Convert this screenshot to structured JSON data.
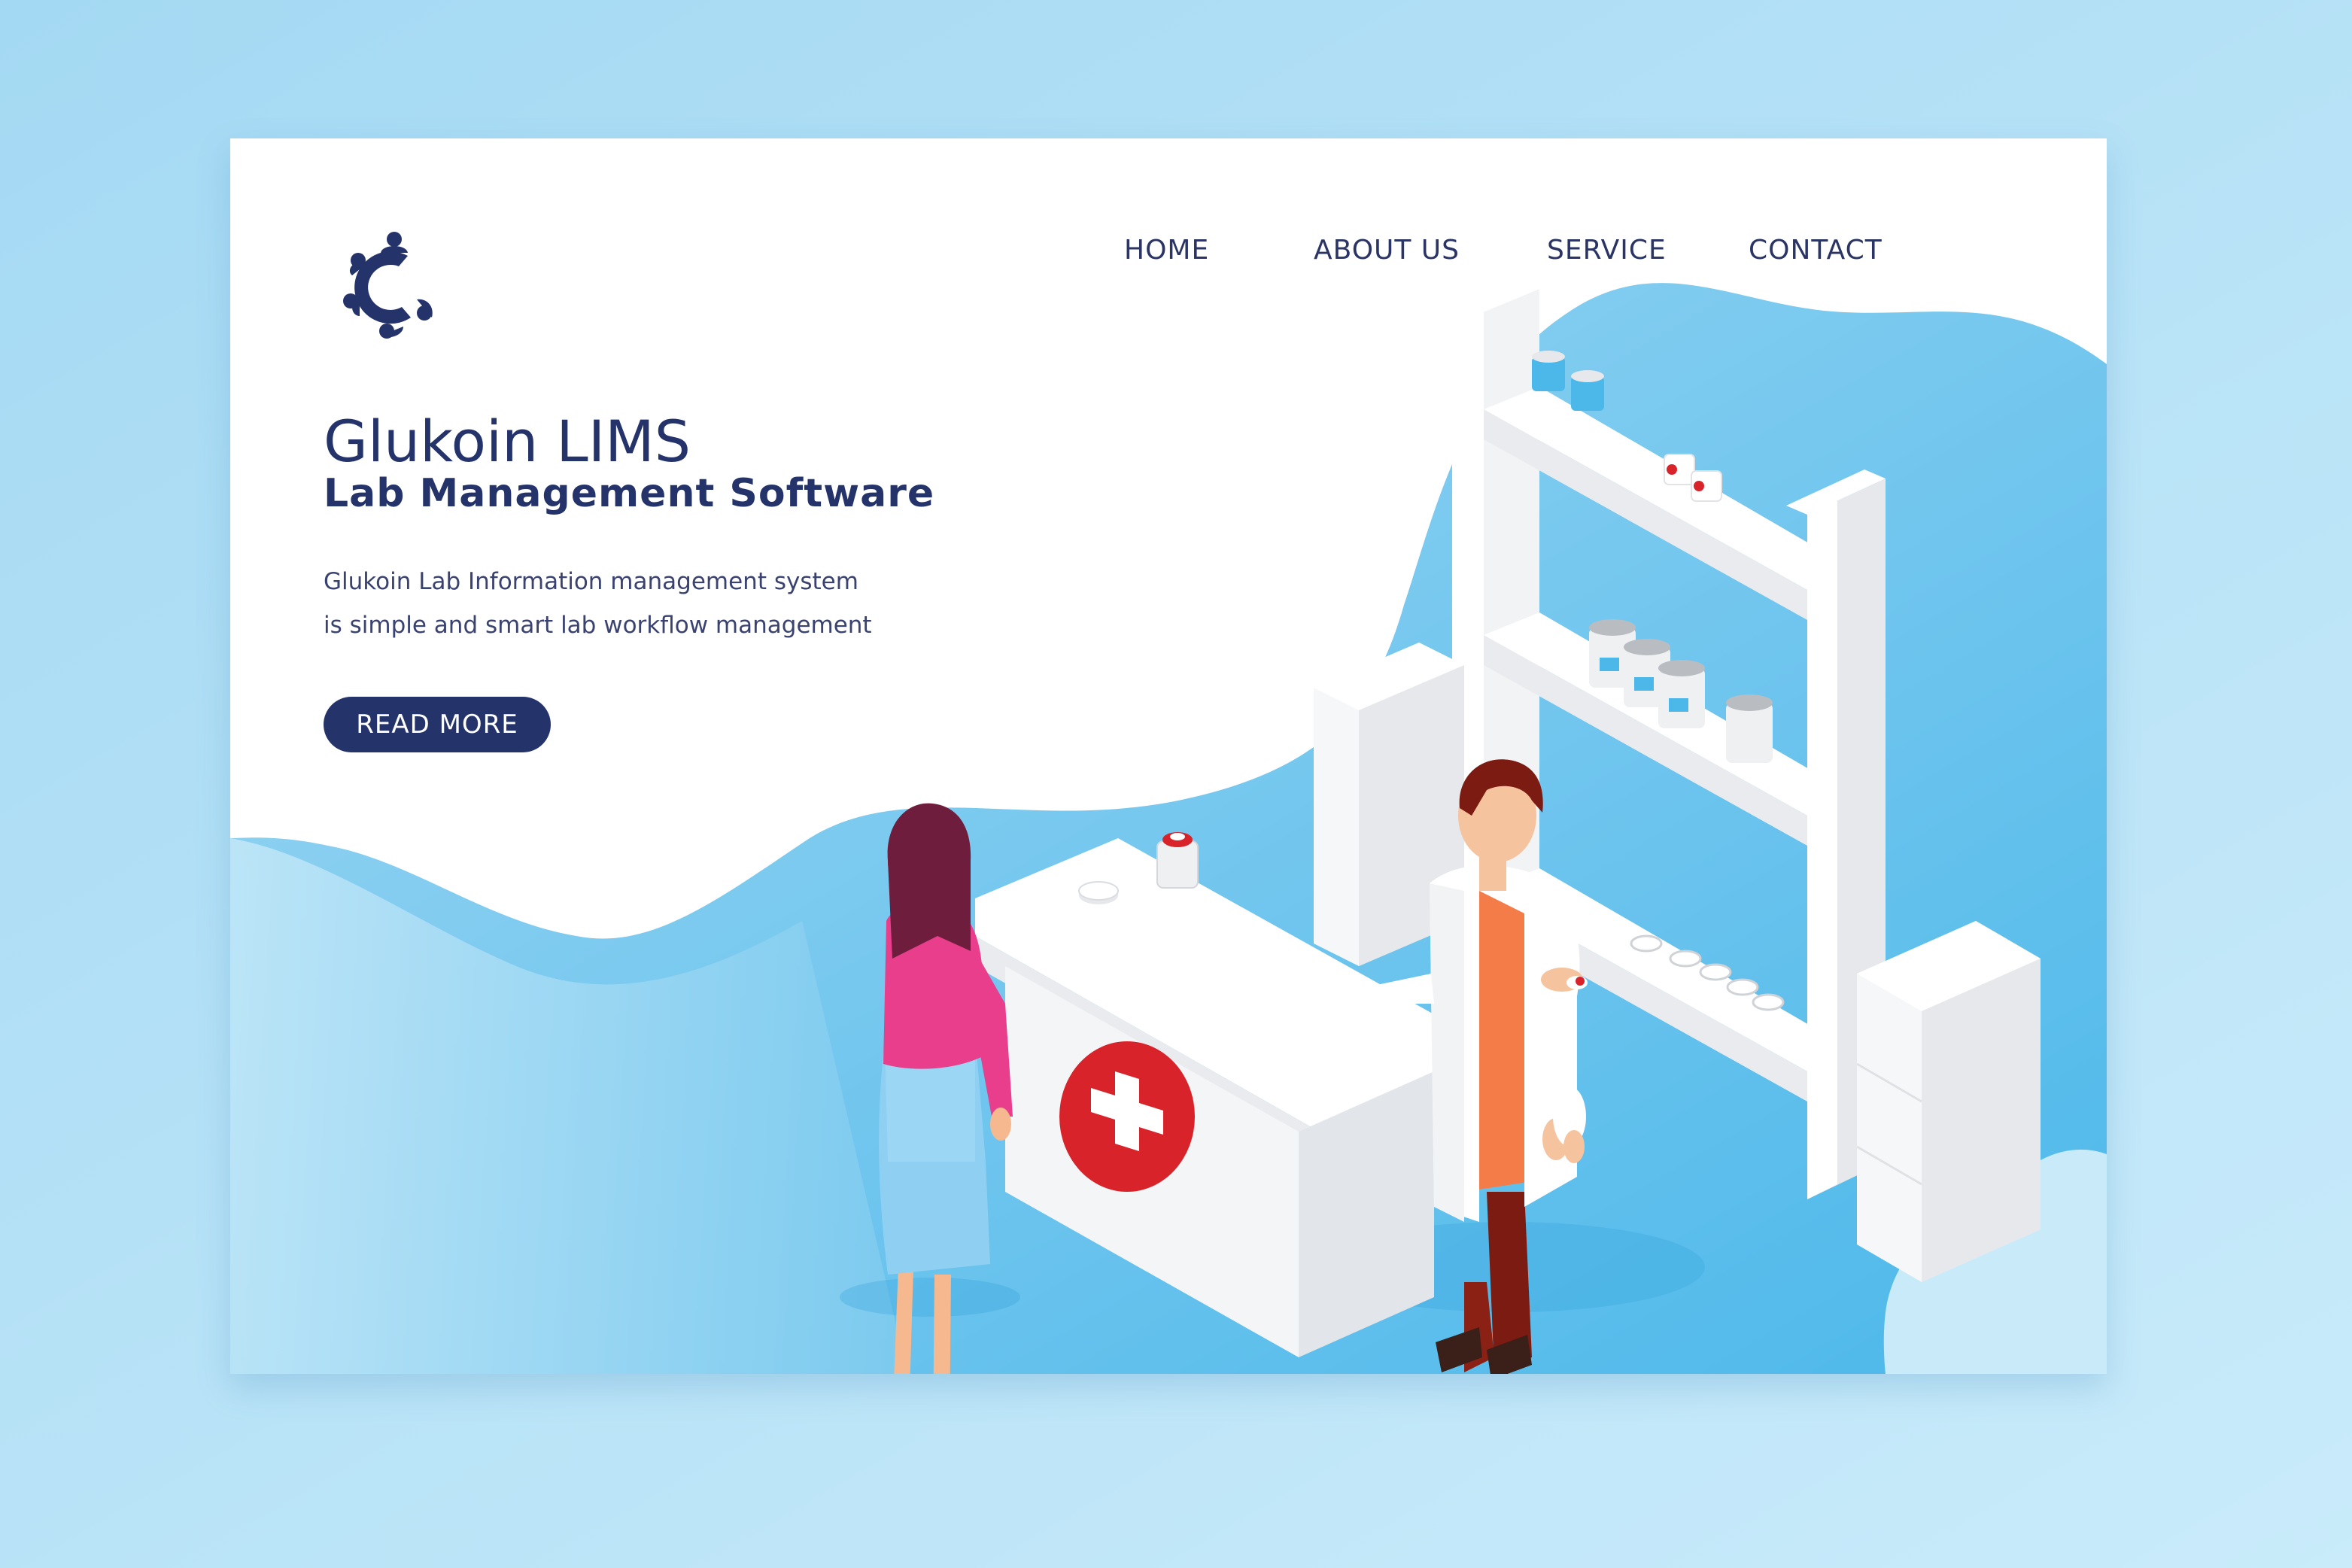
{
  "nav": {
    "items": [
      {
        "label": "HOME"
      },
      {
        "label": "ABOUT US"
      },
      {
        "label": "SERVICE"
      },
      {
        "label": "CONTACT"
      }
    ]
  },
  "hero": {
    "title": "Glukoin LIMS",
    "subtitle": "Lab Management Software",
    "description_lines": [
      "Glukoin Lab Information management system",
      "is simple and smart lab workflow management"
    ],
    "button_label": "READ MORE"
  },
  "logo": {
    "icon": "c-circle-people-logo"
  },
  "colors": {
    "brand_navy": "#25336b",
    "accent_blue": "#4cb8ea",
    "light_blue": "#9fd7f3",
    "red_cross": "#d8232a",
    "woman_top": "#e83e8c",
    "doctor_shirt": "#f47c48"
  }
}
